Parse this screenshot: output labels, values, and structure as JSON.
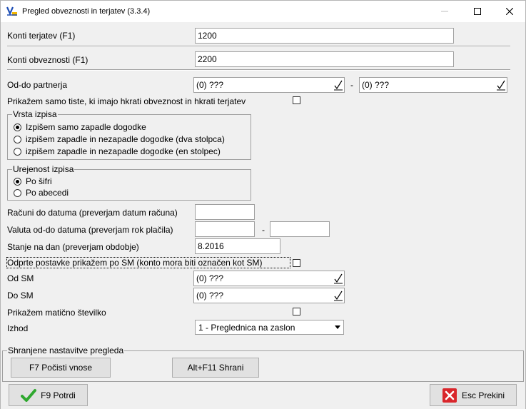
{
  "window": {
    "title": "Pregled obveznosti in terjatev  (3.3.4)"
  },
  "fields": {
    "konti_terjatev_label": "Konti terjatev (F1)",
    "konti_terjatev_value": "1200",
    "konti_obveznosti_label": "Konti obveznosti (F1)",
    "konti_obveznosti_value": "2200",
    "od_do_partnerja_label": "Od-do partnerja",
    "partner_from": "(0) ???",
    "partner_dash": "-",
    "partner_to": "(0) ???",
    "prikazem_samo_tiste_label": "Prikažem samo tiste, ki imajo hkrati obveznost in hkrati terjatev",
    "racuni_do_datuma_label": "Računi do datuma (preverjam datum računa)",
    "racuni_do_datuma_value": "",
    "valuta_od_do_label": "Valuta od-do datuma (preverjam rok plačila)",
    "valuta_dash": "-",
    "valuta_from": "",
    "valuta_to": "",
    "stanje_na_dan_label": "Stanje na dan (preverjam obdobje)",
    "stanje_na_dan_value": "8.2016",
    "odprte_postavke_label": "Odprte postavke prikažem po SM (konto mora biti označen kot SM)",
    "od_sm_label": "Od SM",
    "od_sm_value": "(0) ???",
    "do_sm_label": "Do SM",
    "do_sm_value": "(0) ???",
    "maticno_stevilko_label": "Prikažem matično številko",
    "izhod_label": "Izhod",
    "izhod_value": "1 - Preglednica na zaslon"
  },
  "vrsta_izpisa": {
    "title": "Vrsta izpisa",
    "options": [
      "Izpišem samo zapadle dogodke",
      "izpišem zapadle in nezapadle dogodke (dva stolpca)",
      "izpišem zapadle in nezapadle dogodke (en stolpec)"
    ],
    "selected": 0
  },
  "urejenost_izpisa": {
    "title": "Urejenost izpisa",
    "options": [
      "Po šifri",
      "Po abecedi"
    ],
    "selected": 0
  },
  "shranjene": {
    "title": "Shranjene nastavitve pregleda",
    "reset_button": "F7 Počisti vnose",
    "save_button": "Alt+F11 Shrani"
  },
  "footer": {
    "confirm_button": "F9 Potrdi",
    "cancel_button": "Esc Prekini"
  },
  "colors": {
    "confirm_check": "#2fa82f",
    "cancel_x_bg": "#d9262b",
    "app_icon_accent": "#f2b600",
    "app_icon_blue": "#1f4fb5"
  }
}
